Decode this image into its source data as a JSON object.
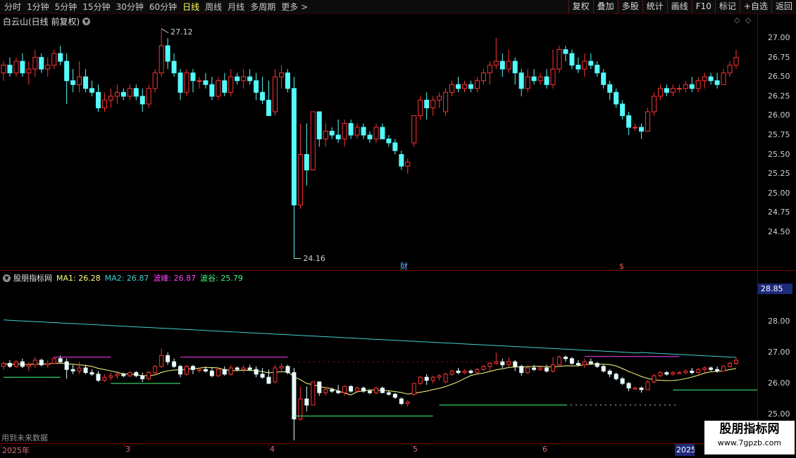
{
  "toolbar": {
    "periods": [
      "分时",
      "1分钟",
      "5分钟",
      "15分钟",
      "30分钟",
      "60分钟",
      "日线",
      "周线",
      "月线",
      "多周期",
      "更多 >"
    ],
    "active_period": "日线",
    "actions": [
      "复权",
      "叠加",
      "多股",
      "统计",
      "画线",
      "F10",
      "标记",
      "+自选",
      "返回"
    ]
  },
  "stock": {
    "title": "白云山(日线 前复权)"
  },
  "price_axis": [
    "27.00",
    "26.75",
    "26.50",
    "26.25",
    "26.00",
    "25.75",
    "25.50",
    "25.25",
    "25.00",
    "24.75",
    "24.50"
  ],
  "annotations": {
    "high": "27.12",
    "low": "24.16",
    "cai": "财",
    "dollar": "$"
  },
  "indicator": {
    "name": "股朋指标网",
    "ma1": "MA1: 26.28",
    "ma2": "MA2: 26.87",
    "peak": "波峰: 26.87",
    "valley": "波谷: 25.79",
    "axis": [
      "28.00",
      "27.00",
      "26.00",
      "25.00"
    ],
    "highlight": "28.85",
    "future_note": "用到未来数据"
  },
  "dates": [
    "2025年",
    "3",
    "4",
    "5",
    "6",
    "2025"
  ],
  "watermark": {
    "line1": "股朋指标网",
    "line2": "www.7gpzb.com"
  },
  "colors": {
    "up": "#ff3232",
    "down": "#54fcfc",
    "ma1": "#ffff80",
    "ma2": "#40d0d0",
    "peak": "#ff40ff",
    "valley": "#40ff80"
  },
  "chart_data": {
    "type": "candlestick",
    "ylim": [
      24.3,
      27.2
    ],
    "candles": [
      {
        "o": 26.55,
        "h": 26.7,
        "l": 26.45,
        "c": 26.65
      },
      {
        "o": 26.65,
        "h": 26.75,
        "l": 26.5,
        "c": 26.55
      },
      {
        "o": 26.55,
        "h": 26.75,
        "l": 26.5,
        "c": 26.7
      },
      {
        "o": 26.7,
        "h": 26.8,
        "l": 26.5,
        "c": 26.55
      },
      {
        "o": 26.55,
        "h": 26.7,
        "l": 26.4,
        "c": 26.6
      },
      {
        "o": 26.6,
        "h": 26.85,
        "l": 26.5,
        "c": 26.75
      },
      {
        "o": 26.75,
        "h": 26.8,
        "l": 26.55,
        "c": 26.6
      },
      {
        "o": 26.6,
        "h": 26.75,
        "l": 26.5,
        "c": 26.65
      },
      {
        "o": 26.65,
        "h": 26.85,
        "l": 26.6,
        "c": 26.8
      },
      {
        "o": 26.8,
        "h": 26.9,
        "l": 26.65,
        "c": 26.7
      },
      {
        "o": 26.7,
        "h": 26.8,
        "l": 26.15,
        "c": 26.45
      },
      {
        "o": 26.45,
        "h": 26.6,
        "l": 26.3,
        "c": 26.4
      },
      {
        "o": 26.4,
        "h": 26.7,
        "l": 26.3,
        "c": 26.5
      },
      {
        "o": 26.5,
        "h": 26.6,
        "l": 26.3,
        "c": 26.35
      },
      {
        "o": 26.35,
        "h": 26.45,
        "l": 26.25,
        "c": 26.3
      },
      {
        "o": 26.3,
        "h": 26.4,
        "l": 26.05,
        "c": 26.1
      },
      {
        "o": 26.1,
        "h": 26.3,
        "l": 26.05,
        "c": 26.2
      },
      {
        "o": 26.2,
        "h": 26.35,
        "l": 26.1,
        "c": 26.25
      },
      {
        "o": 26.25,
        "h": 26.4,
        "l": 26.15,
        "c": 26.3
      },
      {
        "o": 26.3,
        "h": 26.35,
        "l": 26.2,
        "c": 26.25
      },
      {
        "o": 26.25,
        "h": 26.4,
        "l": 26.2,
        "c": 26.35
      },
      {
        "o": 26.35,
        "h": 26.4,
        "l": 26.2,
        "c": 26.25
      },
      {
        "o": 26.25,
        "h": 26.35,
        "l": 26.05,
        "c": 26.15
      },
      {
        "o": 26.15,
        "h": 26.4,
        "l": 26.1,
        "c": 26.35
      },
      {
        "o": 26.35,
        "h": 26.6,
        "l": 26.3,
        "c": 26.55
      },
      {
        "o": 26.55,
        "h": 27.12,
        "l": 26.5,
        "c": 26.9
      },
      {
        "o": 26.9,
        "h": 27.0,
        "l": 26.6,
        "c": 26.7
      },
      {
        "o": 26.7,
        "h": 26.8,
        "l": 26.5,
        "c": 26.55
      },
      {
        "o": 26.55,
        "h": 26.6,
        "l": 26.2,
        "c": 26.3
      },
      {
        "o": 26.3,
        "h": 26.6,
        "l": 26.25,
        "c": 26.55
      },
      {
        "o": 26.55,
        "h": 26.6,
        "l": 26.3,
        "c": 26.45
      },
      {
        "o": 26.45,
        "h": 26.5,
        "l": 26.35,
        "c": 26.45
      },
      {
        "o": 26.45,
        "h": 26.55,
        "l": 26.35,
        "c": 26.4
      },
      {
        "o": 26.4,
        "h": 26.5,
        "l": 26.2,
        "c": 26.25
      },
      {
        "o": 26.25,
        "h": 26.5,
        "l": 26.2,
        "c": 26.45
      },
      {
        "o": 26.45,
        "h": 26.55,
        "l": 26.25,
        "c": 26.3
      },
      {
        "o": 26.3,
        "h": 26.6,
        "l": 26.25,
        "c": 26.5
      },
      {
        "o": 26.5,
        "h": 26.55,
        "l": 26.4,
        "c": 26.45
      },
      {
        "o": 26.45,
        "h": 26.6,
        "l": 26.35,
        "c": 26.5
      },
      {
        "o": 26.5,
        "h": 26.6,
        "l": 26.4,
        "c": 26.45
      },
      {
        "o": 26.45,
        "h": 26.55,
        "l": 26.2,
        "c": 26.3
      },
      {
        "o": 26.3,
        "h": 26.5,
        "l": 26.15,
        "c": 26.2
      },
      {
        "o": 26.2,
        "h": 26.45,
        "l": 26.1,
        "c": 26.0
      },
      {
        "o": 26.05,
        "h": 26.6,
        "l": 26.0,
        "c": 26.5
      },
      {
        "o": 26.5,
        "h": 26.65,
        "l": 26.35,
        "c": 26.55
      },
      {
        "o": 26.55,
        "h": 26.6,
        "l": 26.3,
        "c": 26.35
      },
      {
        "o": 26.35,
        "h": 26.5,
        "l": 24.16,
        "c": 24.85
      },
      {
        "o": 24.85,
        "h": 25.9,
        "l": 24.8,
        "c": 25.5
      },
      {
        "o": 25.5,
        "h": 25.9,
        "l": 25.1,
        "c": 25.3
      },
      {
        "o": 25.3,
        "h": 26.05,
        "l": 25.3,
        "c": 26.05
      },
      {
        "o": 26.05,
        "h": 26.05,
        "l": 25.6,
        "c": 25.7
      },
      {
        "o": 25.7,
        "h": 25.9,
        "l": 25.6,
        "c": 25.8
      },
      {
        "o": 25.8,
        "h": 25.85,
        "l": 25.7,
        "c": 25.75
      },
      {
        "o": 25.75,
        "h": 25.95,
        "l": 25.65,
        "c": 25.7
      },
      {
        "o": 25.7,
        "h": 25.95,
        "l": 25.6,
        "c": 25.9
      },
      {
        "o": 25.9,
        "h": 25.95,
        "l": 25.7,
        "c": 25.75
      },
      {
        "o": 25.75,
        "h": 25.9,
        "l": 25.7,
        "c": 25.85
      },
      {
        "o": 25.85,
        "h": 25.9,
        "l": 25.7,
        "c": 25.75
      },
      {
        "o": 25.75,
        "h": 25.8,
        "l": 25.65,
        "c": 25.7
      },
      {
        "o": 25.7,
        "h": 25.9,
        "l": 25.65,
        "c": 25.85
      },
      {
        "o": 25.85,
        "h": 25.9,
        "l": 25.7,
        "c": 25.7
      },
      {
        "o": 25.7,
        "h": 25.75,
        "l": 25.6,
        "c": 25.65
      },
      {
        "o": 25.65,
        "h": 25.7,
        "l": 25.5,
        "c": 25.55
      },
      {
        "o": 25.5,
        "h": 25.55,
        "l": 25.3,
        "c": 25.35
      },
      {
        "o": 25.35,
        "h": 25.45,
        "l": 25.25,
        "c": 25.4
      },
      {
        "o": 25.65,
        "h": 26.0,
        "l": 25.6,
        "c": 26.0
      },
      {
        "o": 26.0,
        "h": 26.25,
        "l": 25.95,
        "c": 26.2
      },
      {
        "o": 26.2,
        "h": 26.3,
        "l": 25.95,
        "c": 26.1
      },
      {
        "o": 26.1,
        "h": 26.25,
        "l": 26.0,
        "c": 26.2
      },
      {
        "o": 26.2,
        "h": 26.3,
        "l": 26.1,
        "c": 26.25
      },
      {
        "o": 26.05,
        "h": 26.35,
        "l": 26.0,
        "c": 26.3
      },
      {
        "o": 26.3,
        "h": 26.45,
        "l": 26.25,
        "c": 26.4
      },
      {
        "o": 26.4,
        "h": 26.5,
        "l": 26.3,
        "c": 26.35
      },
      {
        "o": 26.35,
        "h": 26.45,
        "l": 26.3,
        "c": 26.4
      },
      {
        "o": 26.4,
        "h": 26.45,
        "l": 26.3,
        "c": 26.35
      },
      {
        "o": 26.35,
        "h": 26.5,
        "l": 26.3,
        "c": 26.45
      },
      {
        "o": 26.45,
        "h": 26.6,
        "l": 26.4,
        "c": 26.55
      },
      {
        "o": 26.55,
        "h": 26.7,
        "l": 26.4,
        "c": 26.65
      },
      {
        "o": 26.65,
        "h": 27.0,
        "l": 26.6,
        "c": 26.7
      },
      {
        "o": 26.7,
        "h": 26.8,
        "l": 26.5,
        "c": 26.6
      },
      {
        "o": 26.6,
        "h": 26.85,
        "l": 26.55,
        "c": 26.7
      },
      {
        "o": 26.7,
        "h": 26.75,
        "l": 26.4,
        "c": 26.55
      },
      {
        "o": 26.55,
        "h": 26.6,
        "l": 26.25,
        "c": 26.35
      },
      {
        "o": 26.35,
        "h": 26.6,
        "l": 26.3,
        "c": 26.5
      },
      {
        "o": 26.5,
        "h": 26.6,
        "l": 26.4,
        "c": 26.45
      },
      {
        "o": 26.45,
        "h": 26.55,
        "l": 26.4,
        "c": 26.5
      },
      {
        "o": 26.5,
        "h": 26.6,
        "l": 26.35,
        "c": 26.4
      },
      {
        "o": 26.4,
        "h": 26.85,
        "l": 26.35,
        "c": 26.6
      },
      {
        "o": 26.6,
        "h": 26.9,
        "l": 26.55,
        "c": 26.85
      },
      {
        "o": 26.85,
        "h": 26.9,
        "l": 26.7,
        "c": 26.8
      },
      {
        "o": 26.8,
        "h": 26.85,
        "l": 26.6,
        "c": 26.65
      },
      {
        "o": 26.65,
        "h": 26.75,
        "l": 26.55,
        "c": 26.6
      },
      {
        "o": 26.6,
        "h": 26.8,
        "l": 26.5,
        "c": 26.7
      },
      {
        "o": 26.7,
        "h": 26.8,
        "l": 26.6,
        "c": 26.65
      },
      {
        "o": 26.65,
        "h": 26.7,
        "l": 26.5,
        "c": 26.55
      },
      {
        "o": 26.55,
        "h": 26.6,
        "l": 26.35,
        "c": 26.4
      },
      {
        "o": 26.4,
        "h": 26.45,
        "l": 26.2,
        "c": 26.3
      },
      {
        "o": 26.3,
        "h": 26.35,
        "l": 26.1,
        "c": 26.15
      },
      {
        "o": 26.15,
        "h": 26.2,
        "l": 25.95,
        "c": 26.0
      },
      {
        "o": 26.0,
        "h": 26.05,
        "l": 25.75,
        "c": 25.85
      },
      {
        "o": 25.85,
        "h": 25.9,
        "l": 25.8,
        "c": 25.85
      },
      {
        "o": 25.85,
        "h": 25.9,
        "l": 25.7,
        "c": 25.8
      },
      {
        "o": 25.8,
        "h": 26.1,
        "l": 25.8,
        "c": 26.05
      },
      {
        "o": 26.05,
        "h": 26.3,
        "l": 26.0,
        "c": 26.25
      },
      {
        "o": 26.25,
        "h": 26.4,
        "l": 26.2,
        "c": 26.35
      },
      {
        "o": 26.35,
        "h": 26.4,
        "l": 26.25,
        "c": 26.3
      },
      {
        "o": 26.3,
        "h": 26.4,
        "l": 26.25,
        "c": 26.35
      },
      {
        "o": 26.35,
        "h": 26.4,
        "l": 26.3,
        "c": 26.35
      },
      {
        "o": 26.35,
        "h": 26.45,
        "l": 26.3,
        "c": 26.4
      },
      {
        "o": 26.4,
        "h": 26.5,
        "l": 26.3,
        "c": 26.35
      },
      {
        "o": 26.35,
        "h": 26.5,
        "l": 26.3,
        "c": 26.45
      },
      {
        "o": 26.45,
        "h": 26.55,
        "l": 26.35,
        "c": 26.5
      },
      {
        "o": 26.5,
        "h": 26.55,
        "l": 26.4,
        "c": 26.45
      },
      {
        "o": 26.45,
        "h": 26.55,
        "l": 26.35,
        "c": 26.4
      },
      {
        "o": 26.4,
        "h": 26.6,
        "l": 26.4,
        "c": 26.55
      },
      {
        "o": 26.55,
        "h": 26.7,
        "l": 26.5,
        "c": 26.65
      },
      {
        "o": 26.65,
        "h": 26.85,
        "l": 26.6,
        "c": 26.75
      }
    ]
  }
}
